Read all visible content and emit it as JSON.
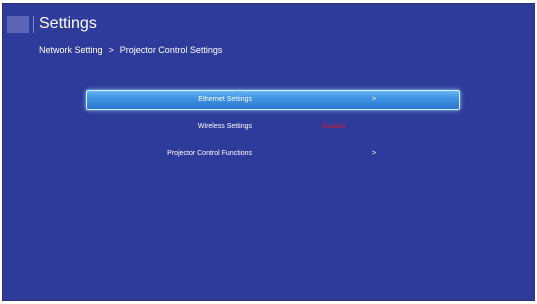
{
  "header": {
    "title": "Settings",
    "breadcrumb": {
      "parent": "Network Setting",
      "separator": ">",
      "current": "Projector Control Settings"
    }
  },
  "menu": {
    "items": [
      {
        "label": "Ethernet Settings",
        "value": "",
        "arrow": ">"
      },
      {
        "label": "Wireless Settings",
        "value": "Disabled",
        "arrow": ""
      },
      {
        "label": "Projector Control Functions",
        "value": "",
        "arrow": ">"
      }
    ]
  },
  "colors": {
    "background": "#2f3b9a",
    "selected_highlight": "#3f92e2",
    "disabled_text": "#d51931",
    "text": "#ffffff"
  },
  "icons": {
    "title_block": "title-block-icon"
  }
}
